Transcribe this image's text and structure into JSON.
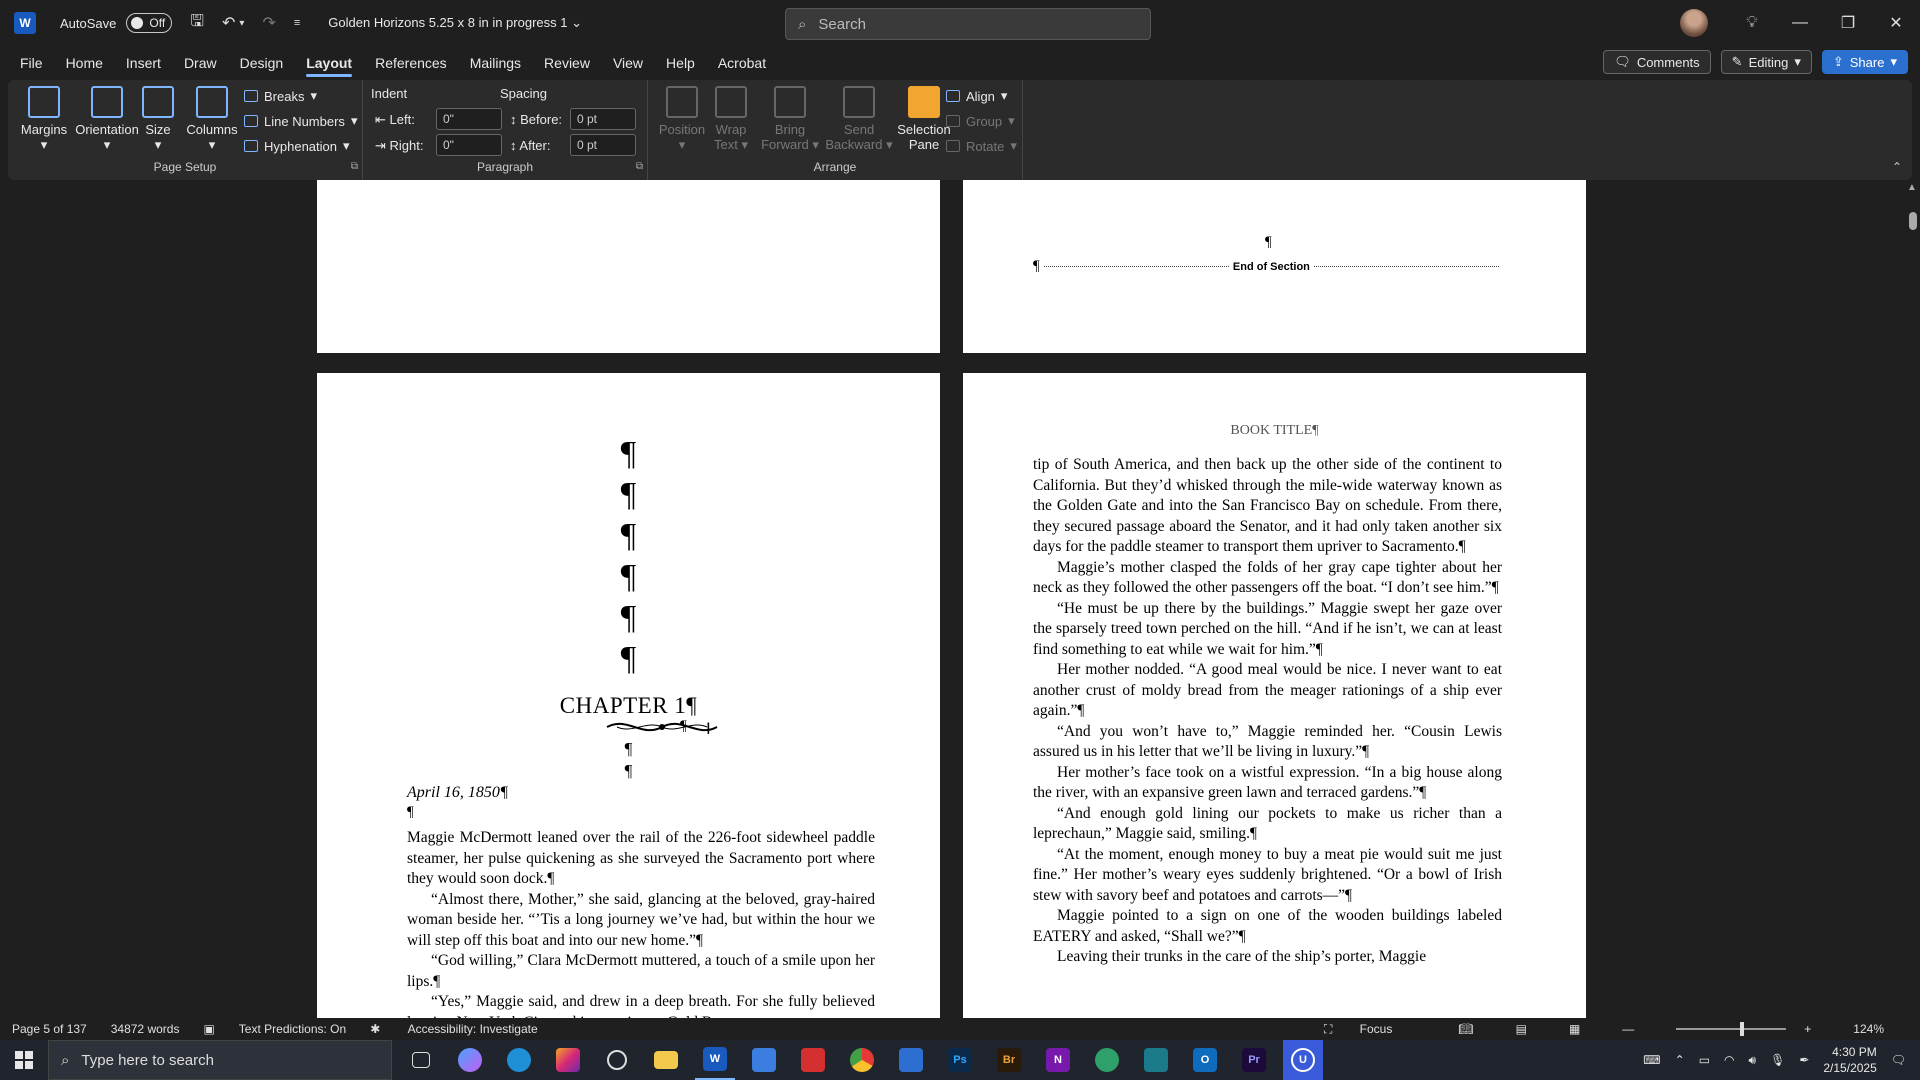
{
  "titlebar": {
    "app_logo": "W",
    "autosave_label": "AutoSave",
    "autosave_state": "Off",
    "doc_title": "Golden Horizons 5.25 x 8 in in progress 1",
    "search_placeholder": "Search"
  },
  "menu": {
    "tabs": [
      "File",
      "Home",
      "Insert",
      "Draw",
      "Design",
      "Layout",
      "References",
      "Mailings",
      "Review",
      "View",
      "Help",
      "Acrobat"
    ],
    "active_tab": "Layout",
    "comments_label": "Comments",
    "editing_label": "Editing",
    "share_label": "Share"
  },
  "ribbon": {
    "page_setup": {
      "label": "Page Setup",
      "margins": "Margins",
      "orientation": "Orientation",
      "size": "Size",
      "columns": "Columns",
      "breaks": "Breaks",
      "line_numbers": "Line Numbers",
      "hyphenation": "Hyphenation"
    },
    "paragraph": {
      "label": "Paragraph",
      "indent_label": "Indent",
      "spacing_label": "Spacing",
      "left_label": "Left:",
      "left_value": "0\"",
      "right_label": "Right:",
      "right_value": "0\"",
      "before_label": "Before:",
      "before_value": "0 pt",
      "after_label": "After:",
      "after_value": "0 pt"
    },
    "arrange": {
      "label": "Arrange",
      "position": "Position",
      "wrap_text_1": "Wrap",
      "wrap_text_2": "Text",
      "bring_forward_1": "Bring",
      "bring_forward_2": "Forward",
      "send_backward_1": "Send",
      "send_backward_2": "Backward",
      "selection_pane_1": "Selection",
      "selection_pane_2": "Pane",
      "align": "Align",
      "group": "Group",
      "rotate": "Rotate"
    }
  },
  "document": {
    "pilcrow": "¶",
    "end_of_section": "End of Section",
    "chapter_heading": "CHAPTER 1¶",
    "date_line": "April 16, 1850¶",
    "left_paragraphs": [
      {
        "indent": false,
        "text": "Maggie McDermott leaned over the rail of the 226-foot sidewheel paddle steamer, her pulse quickening as she surveyed the Sacramento port where they would soon dock.¶"
      },
      {
        "indent": true,
        "text": "“Almost there, Mother,” she said, glancing at the beloved, gray-haired woman beside her. “’Tis a long journey we’ve had, but within the hour we will step off this boat and into our new home.”¶"
      },
      {
        "indent": true,
        "text": "“God willing,” Clara McDermott muttered, a touch of a smile upon her lips.¶"
      },
      {
        "indent": true,
        "text": "“Yes,” Maggie said, and drew in a deep breath. For she fully believed leaving New York City and journeying to Gold Bar was"
      }
    ],
    "book_title": "BOOK TITLE¶",
    "right_paragraphs": [
      {
        "indent": false,
        "text": "tip of South America, and then back up the other side of the continent to California. But they’d whisked through the mile-wide waterway known as the Golden Gate and into the San Francisco Bay on schedule. From there, they secured passage aboard the Senator, and it had only taken another six days for the paddle steamer to transport them upriver to Sacramento.¶"
      },
      {
        "indent": true,
        "text": "Maggie’s mother clasped the folds of her gray cape tighter about her neck as they followed the other passengers off the boat. “I don’t see him.”¶"
      },
      {
        "indent": true,
        "text": "“He must be up there by the buildings.” Maggie swept her gaze over the sparsely treed town perched on the hill. “And if he isn’t, we can at least find something to eat while we wait for him.”¶"
      },
      {
        "indent": true,
        "text": "Her mother nodded. “A good meal would be nice. I never want to eat another crust of moldy bread from the meager rationings of a ship ever again.”¶"
      },
      {
        "indent": true,
        "text": "“And you won’t have to,” Maggie reminded her. “Cousin Lewis assured us in his letter that we’ll be living in luxury.”¶"
      },
      {
        "indent": true,
        "text": "Her mother’s face took on a wistful expression. “In a big house along the river, with an expansive green lawn and terraced gardens.”¶"
      },
      {
        "indent": true,
        "text": "“And enough gold lining our pockets to make us richer than a leprechaun,” Maggie said, smiling.¶"
      },
      {
        "indent": true,
        "text": "“At the moment, enough money to buy a meat pie would suit me just fine.” Her mother’s weary eyes suddenly brightened. “Or a bowl of Irish stew with savory beef and potatoes and carrots—”¶"
      },
      {
        "indent": true,
        "text": "Maggie pointed to a sign on one of the wooden buildings labeled EATERY and asked, “Shall we?”¶"
      },
      {
        "indent": true,
        "text": "Leaving their trunks in the care of the ship’s porter, Maggie"
      }
    ]
  },
  "status": {
    "page": "Page 5 of 137",
    "words": "34872 words",
    "text_predictions": "Text Predictions: On",
    "accessibility": "Accessibility: Investigate",
    "focus": "Focus",
    "zoom": "124%"
  },
  "taskbar": {
    "search_placeholder": "Type here to search",
    "time": "4:30 PM",
    "date": "2/15/2025"
  }
}
